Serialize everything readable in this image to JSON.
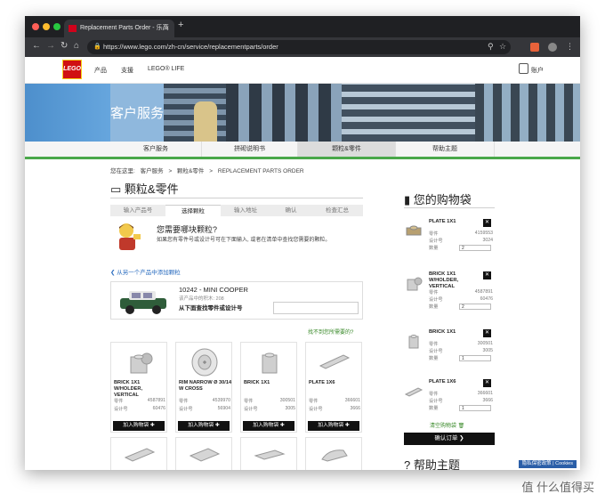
{
  "browser": {
    "tab_title": "Replacement Parts Order - 乐高",
    "tab_close": "×",
    "new_tab": "+",
    "url": "https://www.lego.com/zh-cn/service/replacementparts/order",
    "icons": [
      "back-icon",
      "forward-icon",
      "reload-icon",
      "home-icon",
      "lock-icon",
      "zoom-icon",
      "star-icon",
      "profile-icon",
      "menu-icon"
    ]
  },
  "header": {
    "logo_text": "LEGO",
    "nav": [
      "产品",
      "支援",
      "LEGO® LIFE"
    ],
    "account": "账户"
  },
  "banner": {
    "title": "客户服务"
  },
  "subnav": {
    "items": [
      "客户服务",
      "拼砌说明书",
      "颗粒&零件",
      "帮助主题"
    ],
    "active_index": 2
  },
  "breadcrumb": {
    "prefix": "您在这里:",
    "items": [
      "客户服务",
      "颗粒&零件",
      "REPLACEMENT PARTS ORDER"
    ],
    "sep": ">"
  },
  "main": {
    "title": "颗粒&零件",
    "steps": [
      "输入产品号",
      "选择颗粒",
      "输入地址",
      "确认",
      "检查汇总"
    ],
    "active_step": 1,
    "help_title": "您需要哪块颗粒?",
    "help_text": "如果您有零件号或设计号可在下面输入, 或者在清单中查找您需要的颗粒。",
    "back_link": "从另一个产品中添加颗粒",
    "product": {
      "name": "10242 - MINI COOPER",
      "sub": "该产品中的积木: 208",
      "find_label": "从下面查找零件或设计号"
    },
    "not_found": "找不到您所需要的?",
    "parts_labels": {
      "part_no": "零件",
      "design_no": "设计号",
      "add": "加入购物袋 ✚"
    },
    "parts": [
      {
        "name": "BRICK 1X1 W/HOLDER, VERTICAL",
        "part_no": "4587891",
        "design_no": "60476"
      },
      {
        "name": "RIM NARROW Ø 30/14 W CROSS",
        "part_no": "4539970",
        "design_no": "56904"
      },
      {
        "name": "BRICK 1X1",
        "part_no": "300501",
        "design_no": "3005"
      },
      {
        "name": "PLATE 1X6",
        "part_no": "366601",
        "design_no": "3666"
      }
    ]
  },
  "cart": {
    "title": "您的购物袋",
    "labels": {
      "part_no": "零件",
      "design_no": "设计号",
      "qty": "数量"
    },
    "remove": "✕",
    "items": [
      {
        "name": "PLATE 1X1",
        "part_no": "4159553",
        "design_no": "3024",
        "qty": "2"
      },
      {
        "name": "BRICK 1X1 W/HOLDER, VERTICAL",
        "part_no": "4587891",
        "design_no": "60476",
        "qty": "2"
      },
      {
        "name": "BRICK 1X1",
        "part_no": "300501",
        "design_no": "3005",
        "qty": "1"
      },
      {
        "name": "PLATE 1X6",
        "part_no": "366601",
        "design_no": "3666",
        "qty": "1"
      }
    ],
    "clear": "清空购物袋 🗑",
    "confirm": "确认订单 ❯"
  },
  "help": {
    "title": "帮助主题"
  },
  "footer": {
    "privacy": "隐私保密政策",
    "cookies": "Cookies"
  },
  "watermark": "值 什么值得买"
}
